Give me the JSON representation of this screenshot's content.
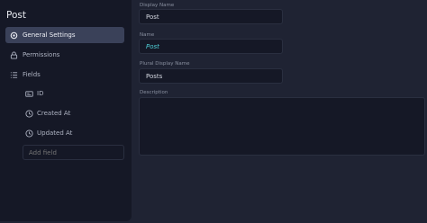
{
  "sidebar": {
    "title": "Post",
    "nav": [
      {
        "label": "General Settings",
        "icon": "gear-icon",
        "active": true
      },
      {
        "label": "Permissions",
        "icon": "lock-icon",
        "active": false
      },
      {
        "label": "Fields",
        "icon": "list-icon",
        "active": false
      }
    ],
    "fields": [
      {
        "label": "ID",
        "icon": "id-card-icon"
      },
      {
        "label": "Created At",
        "icon": "clock-icon"
      },
      {
        "label": "Updated At",
        "icon": "clock-icon"
      }
    ],
    "add_field_placeholder": "Add field"
  },
  "form": {
    "display_name": {
      "label": "Display Name",
      "value": "Post"
    },
    "name": {
      "label": "Name",
      "value": "Post"
    },
    "plural_display_name": {
      "label": "Plural Display Name",
      "value": "Posts"
    },
    "description": {
      "label": "Description",
      "value": ""
    }
  }
}
